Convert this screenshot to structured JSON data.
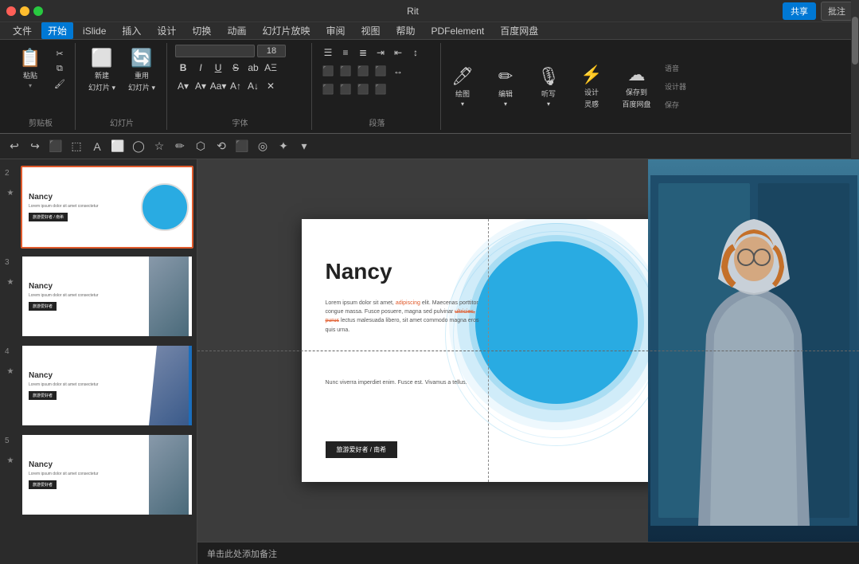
{
  "titleBar": {
    "filename": "Rit",
    "shareLabel": "共享",
    "commentLabel": "批注"
  },
  "menuBar": {
    "items": [
      "文件",
      "开始",
      "iSlide",
      "插入",
      "设计",
      "切换",
      "动画",
      "幻灯片放映",
      "审阅",
      "视图",
      "帮助",
      "PDFelement",
      "百度网盘"
    ],
    "activeItem": "开始"
  },
  "ribbon": {
    "groups": [
      {
        "label": "剪贴板",
        "buttons": [
          {
            "id": "paste",
            "icon": "📋",
            "text": "粘贴"
          },
          {
            "id": "cut",
            "icon": "✂",
            "text": ""
          },
          {
            "id": "copy",
            "icon": "📄",
            "text": ""
          }
        ]
      },
      {
        "label": "幻灯片",
        "buttons": [
          {
            "id": "new-slide",
            "icon": "➕",
            "text": "新建\n幻灯片"
          },
          {
            "id": "reuse-slide",
            "icon": "🔄",
            "text": "重用\n幻灯片"
          }
        ]
      },
      {
        "label": "字体",
        "fontName": "",
        "fontSize": "18",
        "formatButtons": [
          "B",
          "I",
          "U",
          "S",
          "ab",
          "AΞ"
        ],
        "colorButtons": [
          "A▼",
          "A▼",
          "Aa▼",
          "A▼",
          "A▼",
          "A▼"
        ]
      },
      {
        "label": "段落",
        "buttons": [
          {
            "id": "list-bullet",
            "icon": "☰"
          },
          {
            "id": "list-number",
            "icon": "≡"
          },
          {
            "id": "list-multi",
            "icon": "≣"
          },
          {
            "id": "indent",
            "icon": "⇥"
          },
          {
            "id": "align-left",
            "icon": "⬛"
          },
          {
            "id": "align-center",
            "icon": "⬛"
          },
          {
            "id": "align-right",
            "icon": "⬛"
          }
        ]
      },
      {
        "label": "",
        "buttons": [
          {
            "id": "draw",
            "icon": "🖊",
            "text": "绘图"
          },
          {
            "id": "edit",
            "icon": "✏",
            "text": "编辑"
          },
          {
            "id": "dictate",
            "icon": "🎙",
            "text": "听写"
          },
          {
            "id": "designer",
            "icon": "⚡",
            "text": "设计\n灵感"
          },
          {
            "id": "save-cloud",
            "icon": "☁",
            "text": "保存到\n百度网盘"
          }
        ]
      }
    ]
  },
  "toolbar2": {
    "icons": [
      "↩",
      "↪",
      "⬛",
      "⬚",
      "A",
      "⬜",
      "◯",
      "☆",
      "✏",
      "⬡",
      "⟲",
      "⬛",
      "◈",
      "✦",
      "▾"
    ]
  },
  "slides": [
    {
      "number": "2",
      "starred": true,
      "active": true,
      "title": "Nancy",
      "hasCircle": true,
      "hasPhoto": false
    },
    {
      "number": "3",
      "starred": true,
      "active": false,
      "title": "Nancy",
      "hasCircle": false,
      "hasPhoto": true,
      "photoStyle": "person-gray"
    },
    {
      "number": "4",
      "starred": true,
      "active": false,
      "title": "Nancy",
      "hasCircle": false,
      "hasPhoto": true,
      "photoStyle": "diagonal-blue"
    },
    {
      "number": "5",
      "starred": true,
      "active": false,
      "title": "Nancy",
      "hasCircle": false,
      "hasPhoto": true,
      "photoStyle": "person-gray"
    }
  ],
  "mainSlide": {
    "title": "Nancy",
    "bodyText": "Lorem ipsum dolor sit amet, adipiscing elit. Maecenas porttitor congue massa. Fusce posuere, magna sed pulvinar ultricies, purus lectus malesuada libero, sit amet commodo magna eros quis urna.",
    "bodyText2": "Nunc viverra imperdiet enim. Fusce est. Vivamus a tellus.",
    "ctaLabel": "旅游爱好者 / 南希",
    "highlightWords": "adipiscing",
    "strikeWords": "ultricies, purus"
  },
  "statusBar": {
    "notePrompt": "单击此处添加备注"
  }
}
